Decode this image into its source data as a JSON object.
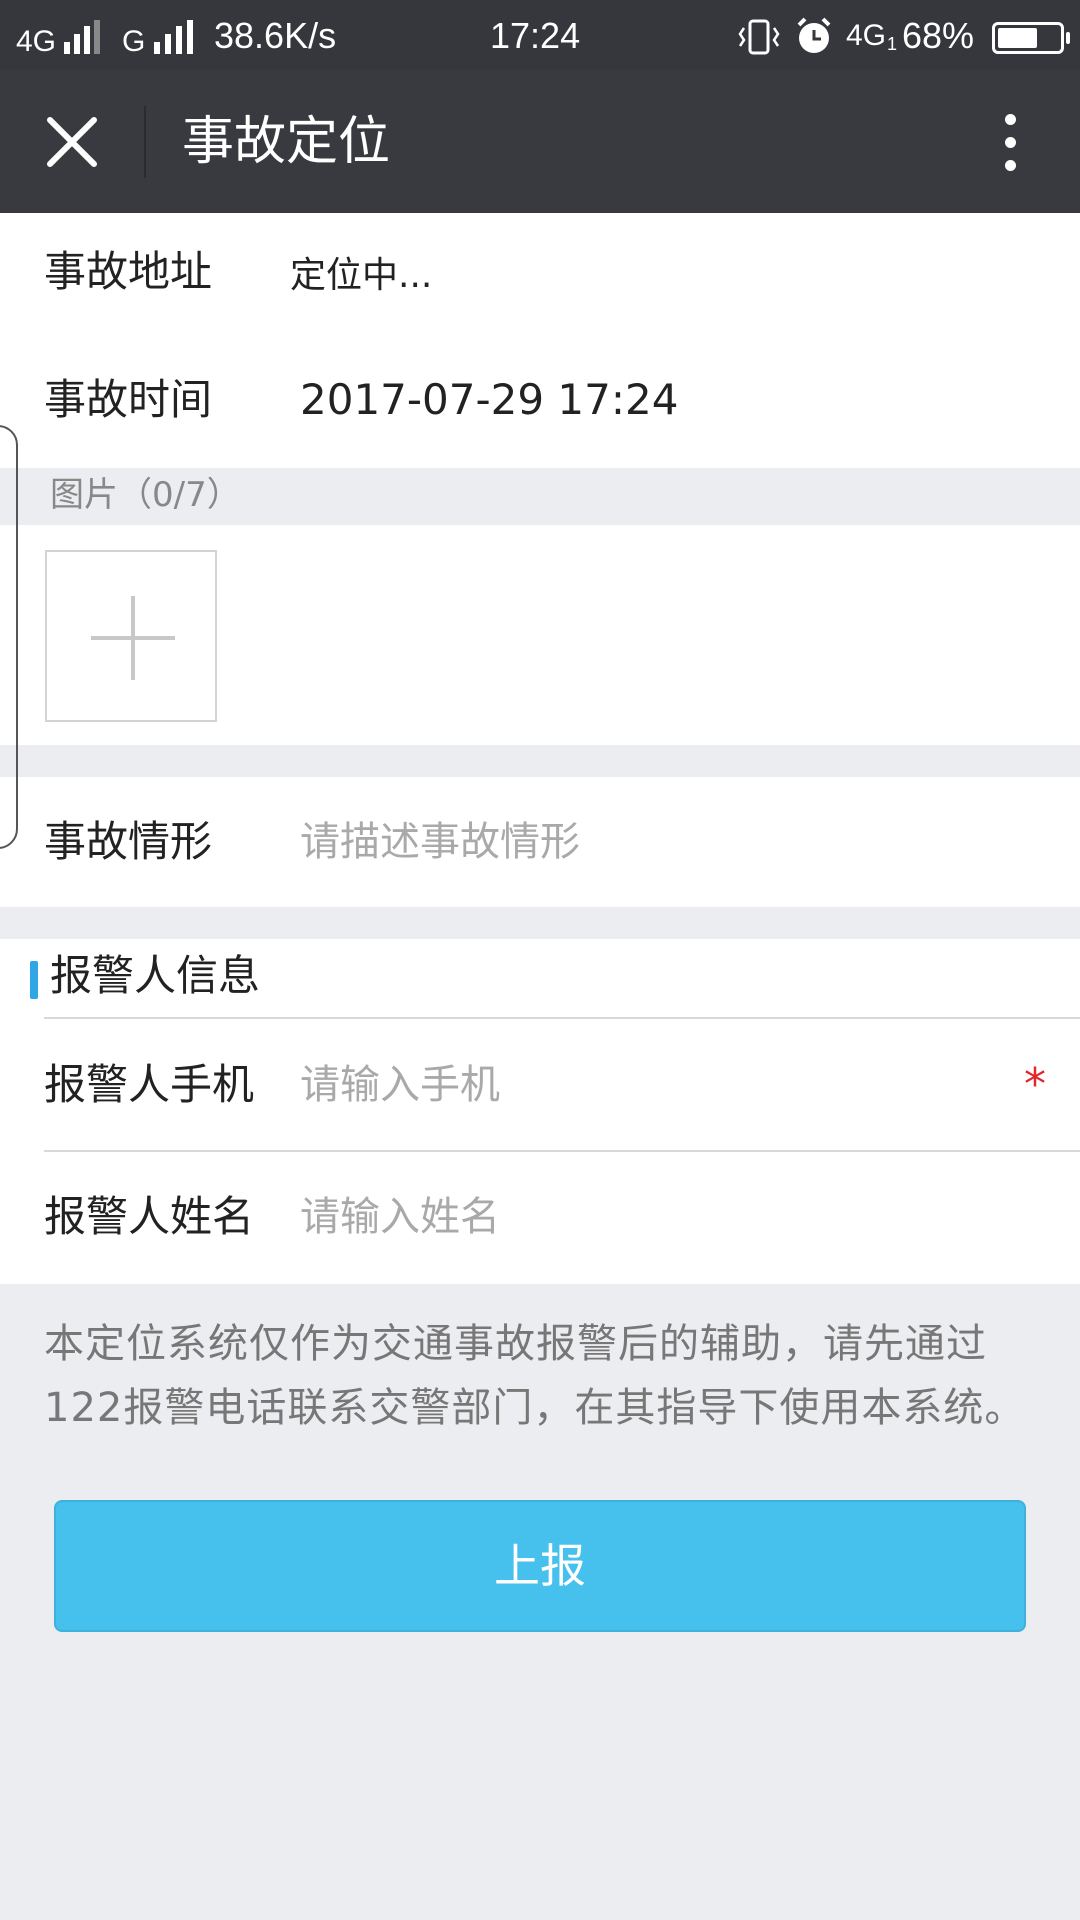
{
  "status_bar": {
    "network1": "4G",
    "network2": "G",
    "speed": "38.6K/s",
    "time": "17:24",
    "network3": "4G",
    "network3_sup": "1",
    "battery_percent": "68%",
    "battery_level": 0.68,
    "icons": [
      "signal-icon",
      "vibrate-icon",
      "alarm-icon",
      "battery-icon"
    ]
  },
  "titlebar": {
    "title": "事故定位",
    "close_icon": "close-icon",
    "more_icon": "more-vertical-icon"
  },
  "accident": {
    "address_label": "事故地址",
    "address_value": "定位中...",
    "time_label": "事故时间",
    "time_value": "2017-07-29 17:24"
  },
  "photos": {
    "title": "图片（0/7）",
    "add_icon": "plus-icon"
  },
  "situation": {
    "label": "事故情形",
    "placeholder": "请描述事故情形"
  },
  "reporter": {
    "section_title": "报警人信息",
    "phone_label": "报警人手机",
    "phone_placeholder": "请输入手机",
    "required_mark": "*",
    "name_label": "报警人姓名",
    "name_placeholder": "请输入姓名"
  },
  "notice": "本定位系统仅作为交通事故报警后的辅助，请先通过122报警电话联系交警部门，在其指导下使用本系统。",
  "submit_label": "上报",
  "colors": {
    "status_bar": "#35373c",
    "title_bar": "#393a3f",
    "accent": "#2fa6e6",
    "submit_button": "#46c0ec",
    "required": "#e3242b",
    "background": "#ecedf1"
  }
}
